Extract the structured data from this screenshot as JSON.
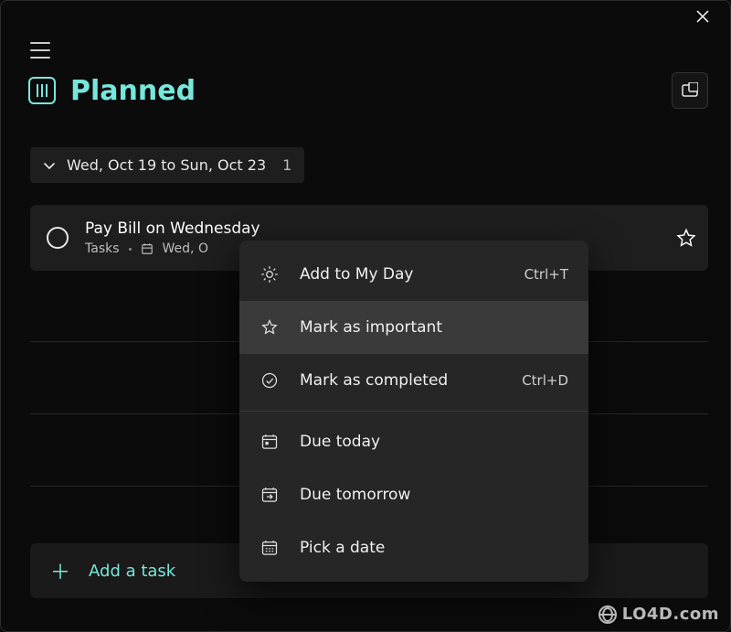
{
  "header": {
    "title": "Planned"
  },
  "date_group": {
    "label": "Wed, Oct 19 to Sun, Oct 23",
    "count": "1"
  },
  "task": {
    "title": "Pay Bill on Wednesday",
    "list_name": "Tasks",
    "due_prefix": "Wed, O"
  },
  "add_task": {
    "label": "Add a task"
  },
  "context_menu": {
    "items": [
      {
        "icon": "sun",
        "label": "Add to My Day",
        "accel": "Ctrl+T"
      },
      {
        "icon": "star",
        "label": "Mark as important",
        "accel": ""
      },
      {
        "icon": "check",
        "label": "Mark as completed",
        "accel": "Ctrl+D"
      },
      {
        "icon": "cal",
        "label": "Due today",
        "accel": ""
      },
      {
        "icon": "cal-next",
        "label": "Due tomorrow",
        "accel": ""
      },
      {
        "icon": "cal-pick",
        "label": "Pick a date",
        "accel": ""
      }
    ],
    "highlighted_index": 1,
    "separator_after_index": 2
  },
  "watermark": "LO4D.com"
}
